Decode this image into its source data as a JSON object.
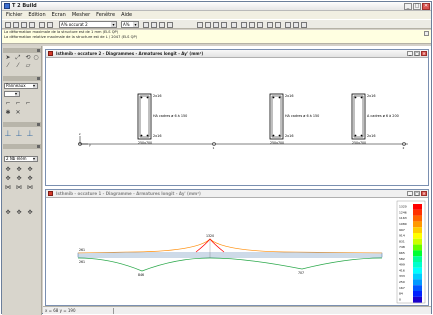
{
  "window": {
    "title": "T 2 Build",
    "minimize": "_",
    "maximize": "□",
    "close": "✕"
  },
  "menu": [
    "Fichier",
    "Edition",
    "Ecran",
    "Mesher",
    "Fenêtre",
    "Aide"
  ],
  "toolbar": {
    "case_select": "A% occurat 2",
    "unit_select": "A%"
  },
  "messages": [
    "La déformation maximale de la structure est de 1 mm (ELS QP)",
    "La déformation relative maximale de la structure est de L / 2047 (ELS QP)"
  ],
  "palette": {
    "select_1": "Panneaux",
    "select_2": "2 Nb élém"
  },
  "window_top": {
    "title": "Isthmib - occature 2 - Diagrammes - Armatures longit - Ay' (mm²)",
    "sections": [
      {
        "top_label": "2x16",
        "stirrup_label": "HA cadres ø 6 à 150",
        "bottom_label": "2x16",
        "size_label": "250x700"
      },
      {
        "top_label": "2x16",
        "stirrup_label": "HA cadres ø 6 à 150",
        "bottom_label": "2x16",
        "size_label": "250x700"
      },
      {
        "top_label": "2x16",
        "stirrup_label": "A cadres ø 6 à 200",
        "bottom_label": "2x16",
        "size_label": "250x700"
      }
    ],
    "support_1": "1",
    "support_2": "2",
    "axis_y": "z",
    "axis_x": "y"
  },
  "window_bottom": {
    "title": "Isthmib - occature 1 - Diagramme - Armatures longit - Ay' (mm²)",
    "left_top_value": "261",
    "left_bottom_value": "261",
    "peak_value": "1320",
    "span1_value": "846",
    "span2_value": "707"
  },
  "legend": {
    "values": [
      "1320",
      "1246",
      "1163",
      "1080",
      "997",
      "914",
      "831",
      "748",
      "665",
      "582",
      "499",
      "416",
      "333",
      "250",
      "167",
      "84",
      "0"
    ],
    "colors": [
      "#ff0000",
      "#ff3300",
      "#ff6600",
      "#ff9900",
      "#ffcc00",
      "#ffff00",
      "#ccff00",
      "#66ff00",
      "#00ff33",
      "#00ff99",
      "#00ffcc",
      "#00ffff",
      "#00ccff",
      "#0099ff",
      "#0055ff",
      "#0022ff",
      "#1a00cc"
    ]
  },
  "status": {
    "coords": "x = 68 y = 190"
  },
  "colors": {
    "accent": "#d43a2b",
    "diagram_red": "#ff0000",
    "frame_blue": "#3a6ea5"
  }
}
